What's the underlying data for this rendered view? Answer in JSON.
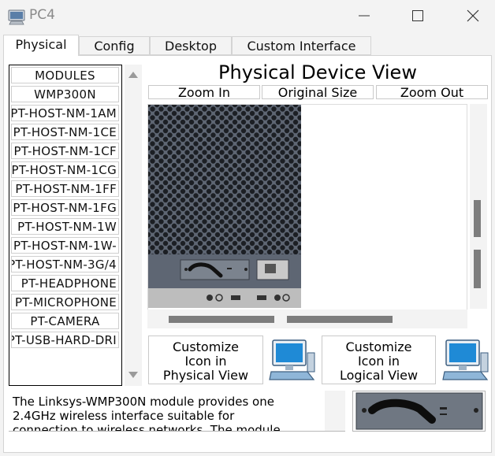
{
  "window": {
    "title": "PC4",
    "app_icon": "packet-tracer-pc-icon",
    "controls": [
      "minimize-icon",
      "maximize-icon",
      "close-icon"
    ]
  },
  "tabs": [
    {
      "label": "Physical",
      "active": true
    },
    {
      "label": "Config",
      "active": false
    },
    {
      "label": "Desktop",
      "active": false
    },
    {
      "label": "Custom Interface",
      "active": false
    }
  ],
  "modules": {
    "header": "MODULES",
    "items": [
      "WMP300N",
      "PT-HOST-NM-1AM",
      "PT-HOST-NM-1CE",
      "PT-HOST-NM-1CF",
      "PT-HOST-NM-1CG",
      "PT-HOST-NM-1FF",
      "PT-HOST-NM-1FG",
      "PT-HOST-NM-1W",
      "PT-HOST-NM-1W-",
      "PT-HOST-NM-3G/4",
      "PT-HEADPHONE",
      "PT-MICROPHONE",
      "PT-CAMERA",
      "PT-USB-HARD-DRI"
    ]
  },
  "physical_view": {
    "title": "Physical Device View",
    "zoom_in": "Zoom In",
    "original_size": "Original Size",
    "zoom_out": "Zoom Out"
  },
  "customize": {
    "physical": {
      "line1": "Customize",
      "line2": "Icon in",
      "line3": "Physical View"
    },
    "logical": {
      "line1": "Customize",
      "line2": "Icon in",
      "line3": "Logical View"
    },
    "icon": "pc-icon"
  },
  "description": {
    "line1": "The Linksys-WMP300N module provides one",
    "line2": "2.4GHz wireless interface suitable for",
    "line3": "connection to wireless networks. The module"
  },
  "colors": {
    "device_chassis": "#5e6673",
    "module_slot": "#7b838e",
    "scroll_thumb": "#7d7d7d",
    "pc_icon_blue": "#1f8ad6"
  }
}
